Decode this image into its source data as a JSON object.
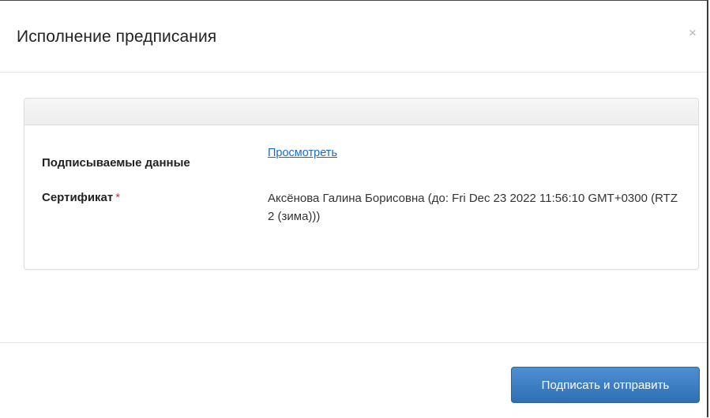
{
  "dialog": {
    "title": "Исполнение предписания",
    "close_glyph": "×",
    "close_icon": "close-icon"
  },
  "panel": {
    "heading": "",
    "rows": [
      {
        "label": "Подписываемые данные",
        "value": "Просмотреть",
        "value_type": "link"
      },
      {
        "label": "Сертификат",
        "required": "*",
        "value": "Аксёнова Галина Борисовна (до: Fri Dec 23 2022 11:56:10 GMT+0300 (RTZ 2 (зима)))",
        "value_type": "text"
      }
    ]
  },
  "footer": {
    "submit_label": "Подписать и отправить"
  },
  "colors": {
    "primary_button": "#3a7cc3",
    "link": "#1a6cc7",
    "required": "#cc3333"
  }
}
